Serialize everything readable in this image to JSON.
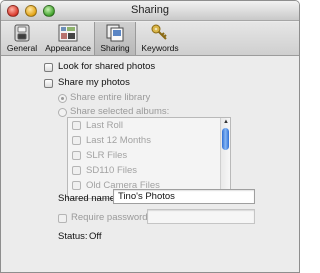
{
  "window": {
    "title": "Sharing"
  },
  "toolbar": {
    "items": [
      {
        "label": "General",
        "icon": "switch-icon"
      },
      {
        "label": "Appearance",
        "icon": "appearance-icon"
      },
      {
        "label": "Sharing",
        "icon": "sharing-icon",
        "selected": true
      },
      {
        "label": "Keywords",
        "icon": "key-icon"
      }
    ]
  },
  "options": {
    "look_for_shared": {
      "label": "Look for shared photos",
      "checked": false
    },
    "share_my_photos": {
      "label": "Share my photos",
      "checked": false
    },
    "share_entire_library": {
      "label": "Share entire library",
      "selected": true,
      "enabled": false
    },
    "share_selected_albums": {
      "label": "Share selected albums:",
      "selected": false,
      "enabled": false
    }
  },
  "albums": [
    {
      "name": "Last Roll"
    },
    {
      "name": "Last 12 Months"
    },
    {
      "name": "SLR Files"
    },
    {
      "name": "SD110 Files"
    },
    {
      "name": "Old Camera Files"
    }
  ],
  "shared_name": {
    "label": "Shared name:",
    "value": "Tino's Photos"
  },
  "require_password": {
    "label": "Require password:",
    "value": ""
  },
  "status": {
    "label": "Status:",
    "value": "Off"
  },
  "colors": {
    "scroll_thumb": "#4a8ee8",
    "window_bg": "#ececec"
  }
}
